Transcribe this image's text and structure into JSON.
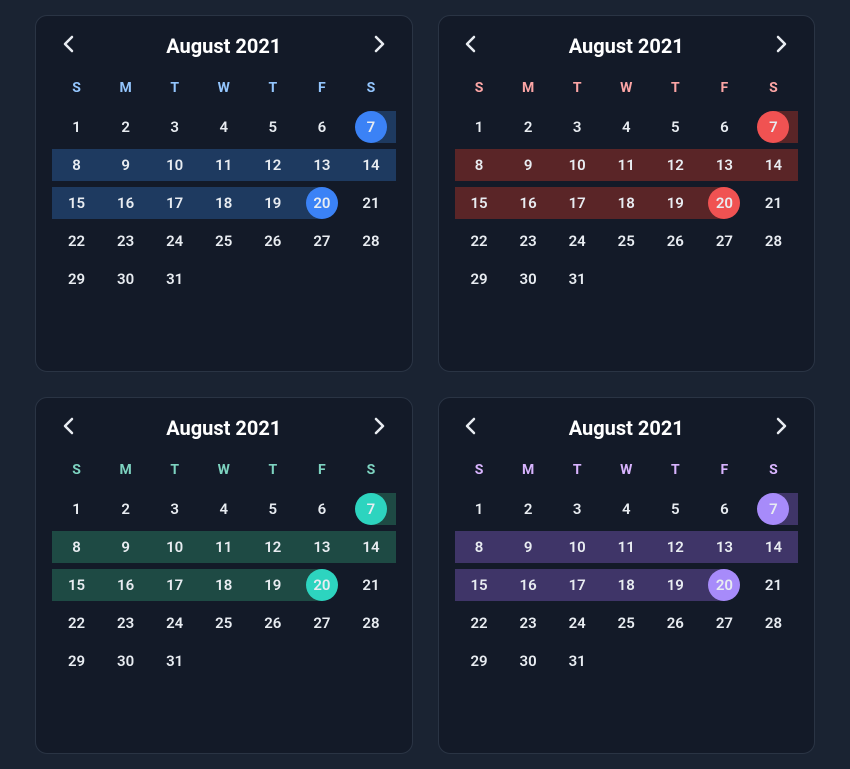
{
  "calendars": [
    {
      "id": "blue",
      "theme": "theme-blue",
      "title": "August 2021",
      "weekdays": [
        "S",
        "M",
        "T",
        "W",
        "T",
        "F",
        "S"
      ],
      "rangeStart": 7,
      "rangeEnd": 20,
      "daysInMonth": 31,
      "firstDayOffset": 0
    },
    {
      "id": "red",
      "theme": "theme-red",
      "title": "August 2021",
      "weekdays": [
        "S",
        "M",
        "T",
        "W",
        "T",
        "F",
        "S"
      ],
      "rangeStart": 7,
      "rangeEnd": 20,
      "daysInMonth": 31,
      "firstDayOffset": 0
    },
    {
      "id": "teal",
      "theme": "theme-teal",
      "title": "August 2021",
      "weekdays": [
        "S",
        "M",
        "T",
        "W",
        "T",
        "F",
        "S"
      ],
      "rangeStart": 7,
      "rangeEnd": 20,
      "daysInMonth": 31,
      "firstDayOffset": 0
    },
    {
      "id": "purple",
      "theme": "theme-purple",
      "title": "August 2021",
      "weekdays": [
        "S",
        "M",
        "T",
        "W",
        "T",
        "F",
        "S"
      ],
      "rangeStart": 7,
      "rangeEnd": 20,
      "daysInMonth": 31,
      "firstDayOffset": 0
    }
  ]
}
